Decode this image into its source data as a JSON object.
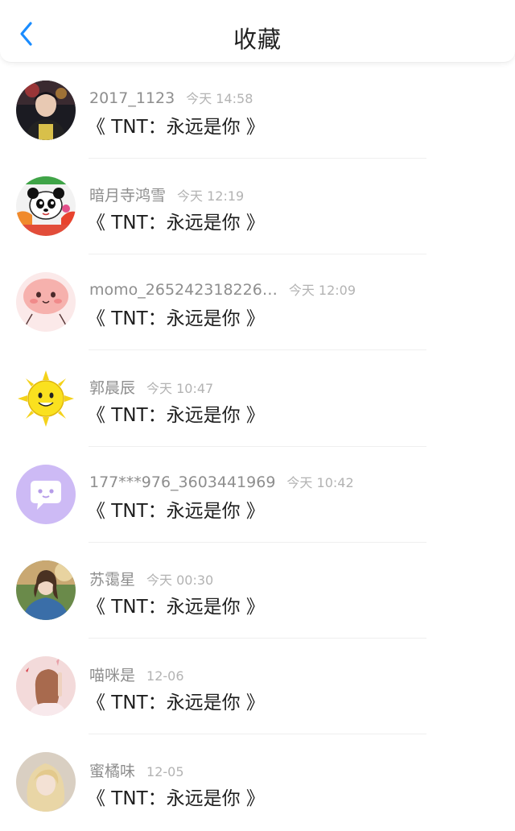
{
  "header": {
    "title": "收藏",
    "back_icon": "chevron-left-icon",
    "accent_color": "#1a8cff"
  },
  "favorites": [
    {
      "avatar": "avatar-photo-boy",
      "name": "2017_1123",
      "time": "今天 14:58",
      "message": "《 TNT：永远是你 》"
    },
    {
      "avatar": "avatar-panda",
      "name": "暗月寺鸿雪",
      "time": "今天 12:19",
      "message": "《 TNT：永远是你 》"
    },
    {
      "avatar": "avatar-pink-blob",
      "name": "momo_265242318226…",
      "time": "今天 12:09",
      "message": "《 TNT：永远是你 》"
    },
    {
      "avatar": "avatar-sun",
      "name": "郭晨辰",
      "time": "今天 10:47",
      "message": "《 TNT：永远是你 》"
    },
    {
      "avatar": "avatar-default-chat",
      "name": "177***976_3603441969",
      "time": "今天 10:42",
      "message": "《 TNT：永远是你 》"
    },
    {
      "avatar": "avatar-photo-girl",
      "name": "苏霭星",
      "time": "今天 00:30",
      "message": "《 TNT：永远是你 》"
    },
    {
      "avatar": "avatar-photo-girl-pink",
      "name": "喵咪是",
      "time": "12-06",
      "message": "《 TNT：永远是你 》"
    },
    {
      "avatar": "avatar-photo-blonde",
      "name": "蜜橘味",
      "time": "12-05",
      "message": "《 TNT：永远是你 》"
    }
  ]
}
